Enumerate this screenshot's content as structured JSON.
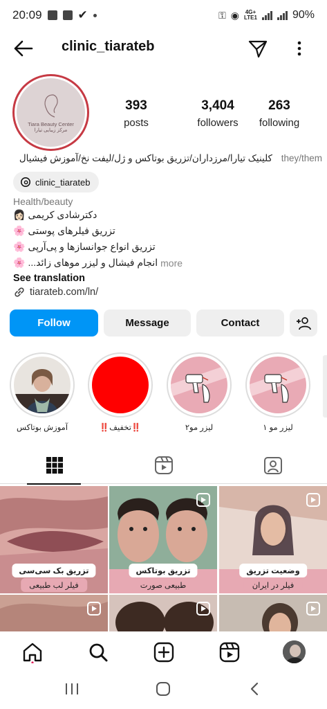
{
  "status_bar": {
    "time": "20:09",
    "network": "4G+",
    "lte": "LTE1",
    "battery": "90%"
  },
  "header": {
    "username": "clinic_tiarateb"
  },
  "profile": {
    "avatar_text_en": "Tiara Beauty Center",
    "avatar_text_fa": "مرکز زیبایی تیارا",
    "stats": [
      {
        "value": "393",
        "label": "posts"
      },
      {
        "value": "3,404",
        "label": "followers"
      },
      {
        "value": "263",
        "label": "following"
      }
    ],
    "bio_headline": "کلینیک تیارا/مرزداران/تزریق بوتاکس و ژل/لیفت نخ/آموزش فیشیال",
    "pronouns": "they/them",
    "threads_handle": "clinic_tiarateb",
    "category": "Health/beauty",
    "bio_lines": [
      {
        "text": "دکترشادی کریمی",
        "emoji": "👩🏻"
      },
      {
        "text": "تزریق فیلرهای پوستی",
        "emoji": "🌸"
      },
      {
        "text": "تزریق انواع جوانسازها و پی‌آرپی",
        "emoji": "🌸"
      },
      {
        "text": "انجام فیشال و لیزر موهای زائد...",
        "emoji": "🌸"
      }
    ],
    "more_label": "more",
    "see_translation": "See translation",
    "link": "tiarateb.com/ln/"
  },
  "actions": {
    "follow": "Follow",
    "message": "Message",
    "contact": "Contact"
  },
  "highlights": [
    {
      "label": "آموزش بوتاکس"
    },
    {
      "label": "‼️تخفیف‼️"
    },
    {
      "label": "لیزر مو۲"
    },
    {
      "label": "لیزر مو ۱"
    }
  ],
  "grid_posts": [
    {
      "title": "تزریق بک سی‌سی",
      "subtitle": "فیلر لب طبیعی"
    },
    {
      "title": "تزریق بوتاکس",
      "subtitle": "طبیعی صورت"
    },
    {
      "title": "وضعیت تزریق",
      "subtitle": "فیلر در ایران"
    }
  ],
  "colors": {
    "accent": "#0095f6",
    "ring": "#c63a44",
    "highlight_red": "#ff0000",
    "pink": "#e7a9b3"
  }
}
